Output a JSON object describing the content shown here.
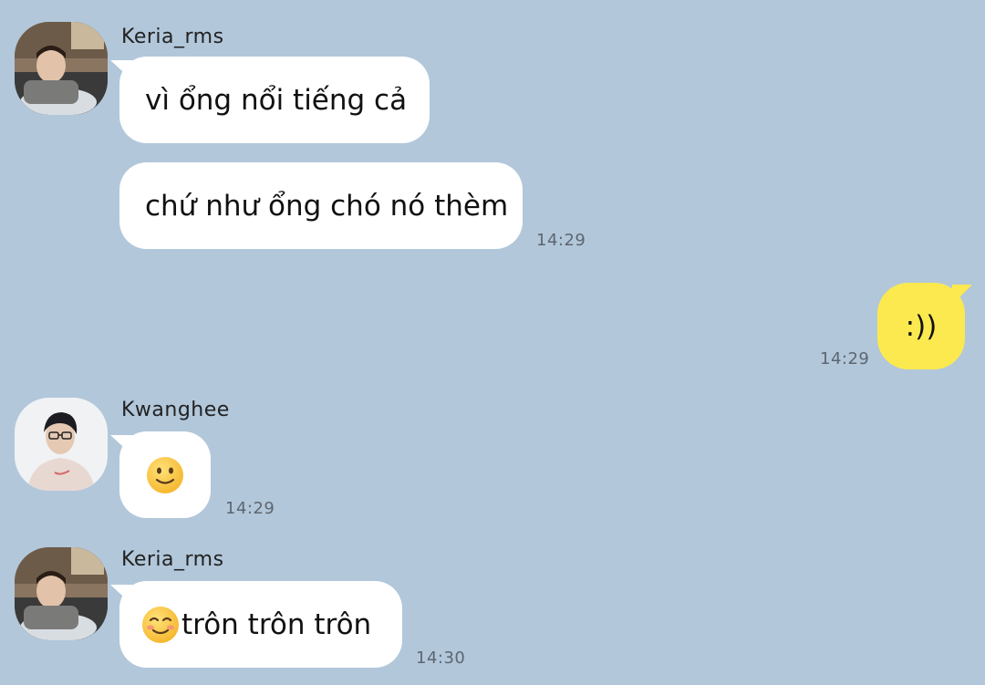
{
  "messages": [
    {
      "group": "keria_1",
      "sender": "Keria_rms",
      "bubbles": [
        "vì ổng nổi tiếng cả",
        "chứ như ổng chó nó thèm"
      ],
      "time": "14:29"
    },
    {
      "group": "mine_1",
      "sender": "",
      "bubbles": [
        ":))"
      ],
      "time": "14:29"
    },
    {
      "group": "kwanghee_1",
      "sender": "Kwanghee",
      "bubbles": [
        "slightly-smiling-face-emoji"
      ],
      "time": "14:29"
    },
    {
      "group": "keria_2",
      "sender": "Keria_rms",
      "bubbles": [
        "trôn trôn trôn"
      ],
      "leading_emoji": "smiling-face-emoji",
      "time": "14:30"
    }
  ],
  "colors": {
    "background": "#b2c7da",
    "incoming_bubble": "#ffffff",
    "outgoing_bubble": "#fbe94f"
  }
}
